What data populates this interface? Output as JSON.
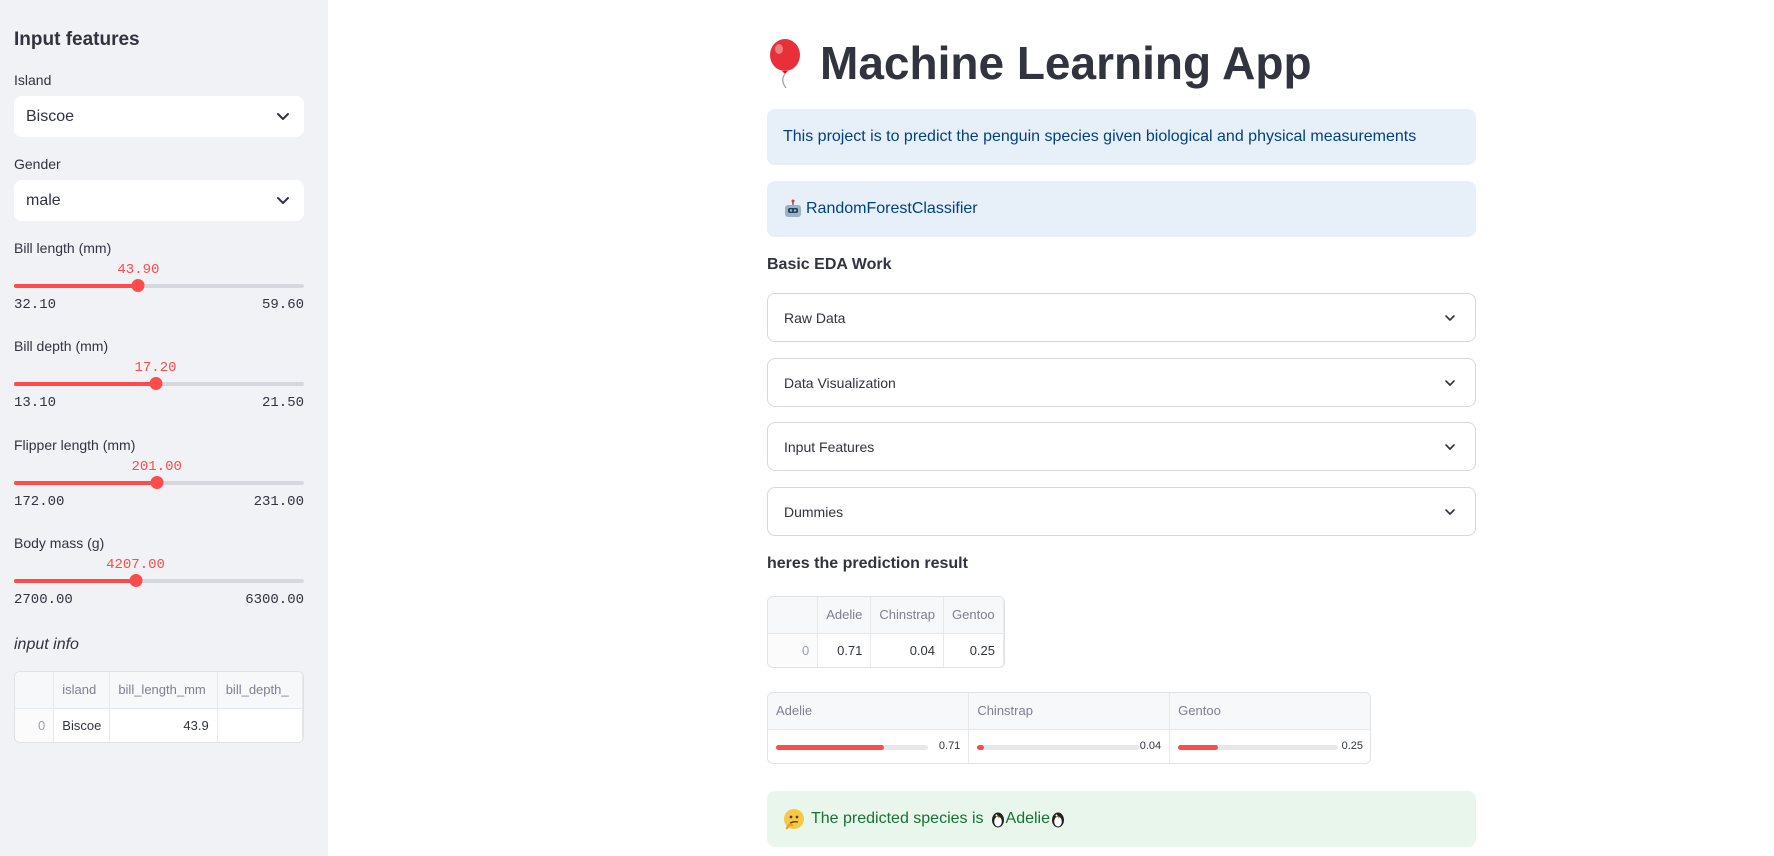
{
  "sidebar": {
    "title": "Input features",
    "island": {
      "label": "Island",
      "value": "Biscoe"
    },
    "gender": {
      "label": "Gender",
      "value": "male"
    },
    "sliders": [
      {
        "label": "Bill length (mm)",
        "value": "43.90",
        "min": "32.10",
        "max": "59.60",
        "fraction": 0.429
      },
      {
        "label": "Bill depth (mm)",
        "value": "17.20",
        "min": "13.10",
        "max": "21.50",
        "fraction": 0.488
      },
      {
        "label": "Flipper length (mm)",
        "value": "201.00",
        "min": "172.00",
        "max": "231.00",
        "fraction": 0.492
      },
      {
        "label": "Body mass (g)",
        "value": "4207.00",
        "min": "2700.00",
        "max": "6300.00",
        "fraction": 0.419
      }
    ],
    "input_info_label": "input info",
    "input_table": {
      "columns": [
        "",
        "island",
        "bill_length_mm",
        "bill_depth_"
      ],
      "rows": [
        [
          "0",
          "Biscoe",
          "43.9",
          ""
        ]
      ]
    }
  },
  "main": {
    "title": "Machine Learning App",
    "info_text": "This project is to predict the penguin species given biological and physical measurements",
    "model_text": "RandomForestClassifier",
    "eda_heading": "Basic EDA Work",
    "expanders": [
      "Raw Data",
      "Data Visualization",
      "Input Features",
      "Dummies"
    ],
    "prediction_heading": "heres the prediction result",
    "proba_table": {
      "columns": [
        "",
        "Adelie",
        "Chinstrap",
        "Gentoo"
      ],
      "rows": [
        [
          "0",
          "0.71",
          "0.04",
          "0.25"
        ]
      ]
    },
    "proba_bars": [
      {
        "label": "Adelie",
        "value": "0.71",
        "fraction": 0.71
      },
      {
        "label": "Chinstrap",
        "value": "0.04",
        "fraction": 0.04
      },
      {
        "label": "Gentoo",
        "value": "0.25",
        "fraction": 0.25
      }
    ],
    "result_prefix": "The predicted species is",
    "result_species": "Adelie"
  },
  "colors": {
    "accent": "#ff4b4b",
    "info_bg": "#e7eff9",
    "info_text": "#004280",
    "success_bg": "#e8f6ec",
    "success_text": "#177233",
    "sidebar_bg": "#f0f2f6"
  },
  "icons": {
    "title": "balloon-icon",
    "model": "robot-icon",
    "result": "thinking-face-icon",
    "species": "penguin-icon",
    "dropdown": "chevron-down-icon"
  }
}
